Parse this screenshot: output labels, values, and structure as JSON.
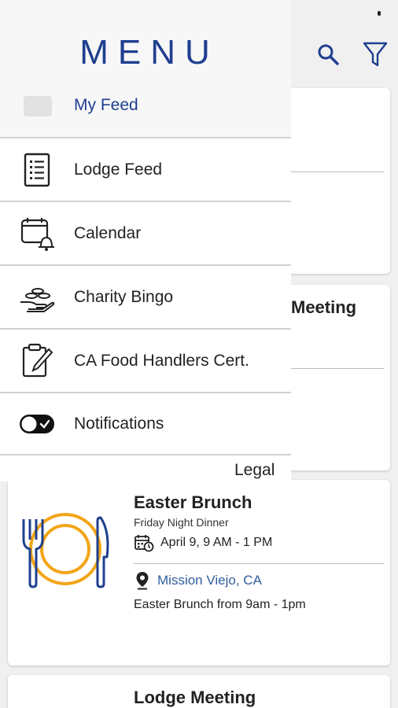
{
  "header": {
    "title": "MENU",
    "search_icon": "search-icon",
    "filter_icon": "filter-icon"
  },
  "drawer": {
    "my_feed": "My Feed",
    "items": [
      {
        "label": "Lodge Feed",
        "icon": "list-icon"
      },
      {
        "label": "Calendar",
        "icon": "calendar-bell-icon"
      },
      {
        "label": "Charity Bingo",
        "icon": "hand-chips-icon"
      },
      {
        "label": "CA Food Handlers Cert.",
        "icon": "clipboard-pen-icon"
      },
      {
        "label": "Notifications",
        "icon": "toggle-icon"
      }
    ],
    "legal": "Legal"
  },
  "feed": {
    "card_b_title": "Meeting",
    "event": {
      "title": "Easter Brunch",
      "subtitle": "Friday Night Dinner",
      "date": "April 9, 9 AM - 1 PM",
      "location": "Mission Viejo, CA",
      "description": "Easter Brunch from 9am - 1pm"
    },
    "next_title": "Lodge Meeting"
  },
  "colors": {
    "brand_blue": "#1f3f8f",
    "link_blue": "#2f5e9e",
    "plate_orange": "#f2a516"
  }
}
